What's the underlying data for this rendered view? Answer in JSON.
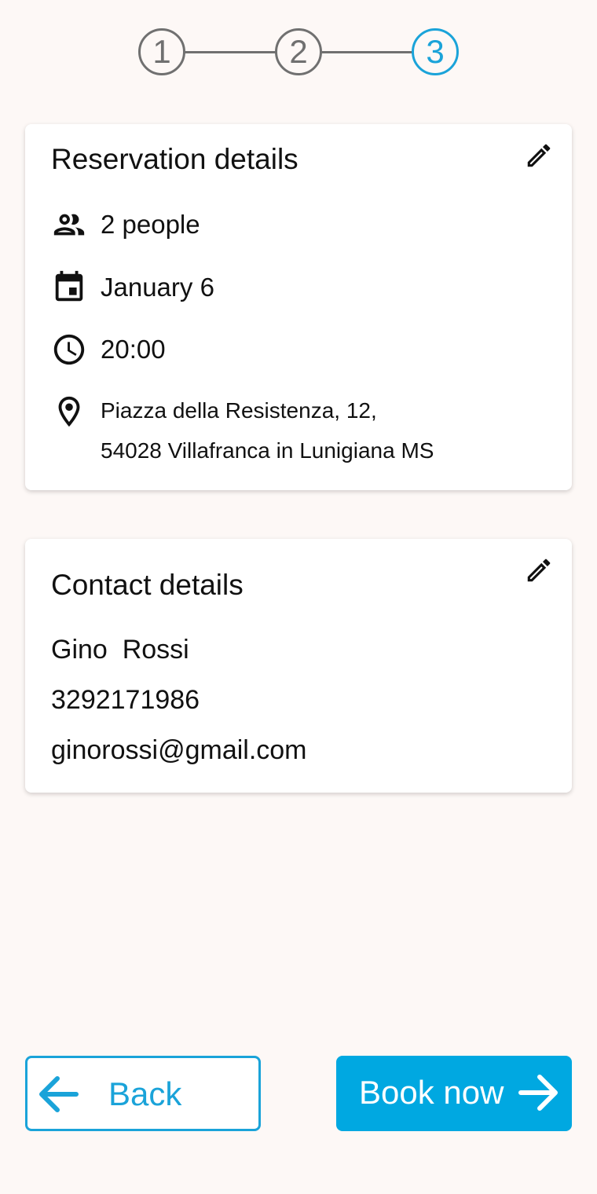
{
  "stepper": {
    "steps": [
      "1",
      "2",
      "3"
    ],
    "active_step": 3,
    "active_color": "#1aa3d9",
    "inactive_color": "#707070"
  },
  "reservation": {
    "title": "Reservation details",
    "edit_icon": "pencil-icon",
    "people": "2 people",
    "date": "January 6",
    "time": "20:00",
    "address_line1": "Piazza della Resistenza, 12,",
    "address_line2": "54028 Villafranca in Lunigiana MS"
  },
  "contact": {
    "title": "Contact details",
    "edit_icon": "pencil-icon",
    "name": "Gino  Rossi",
    "phone": "3292171986",
    "email": "ginorossi@gmail.com"
  },
  "actions": {
    "back_label": "Back",
    "book_label": "Book now",
    "accent_color": "#00a8e1"
  }
}
